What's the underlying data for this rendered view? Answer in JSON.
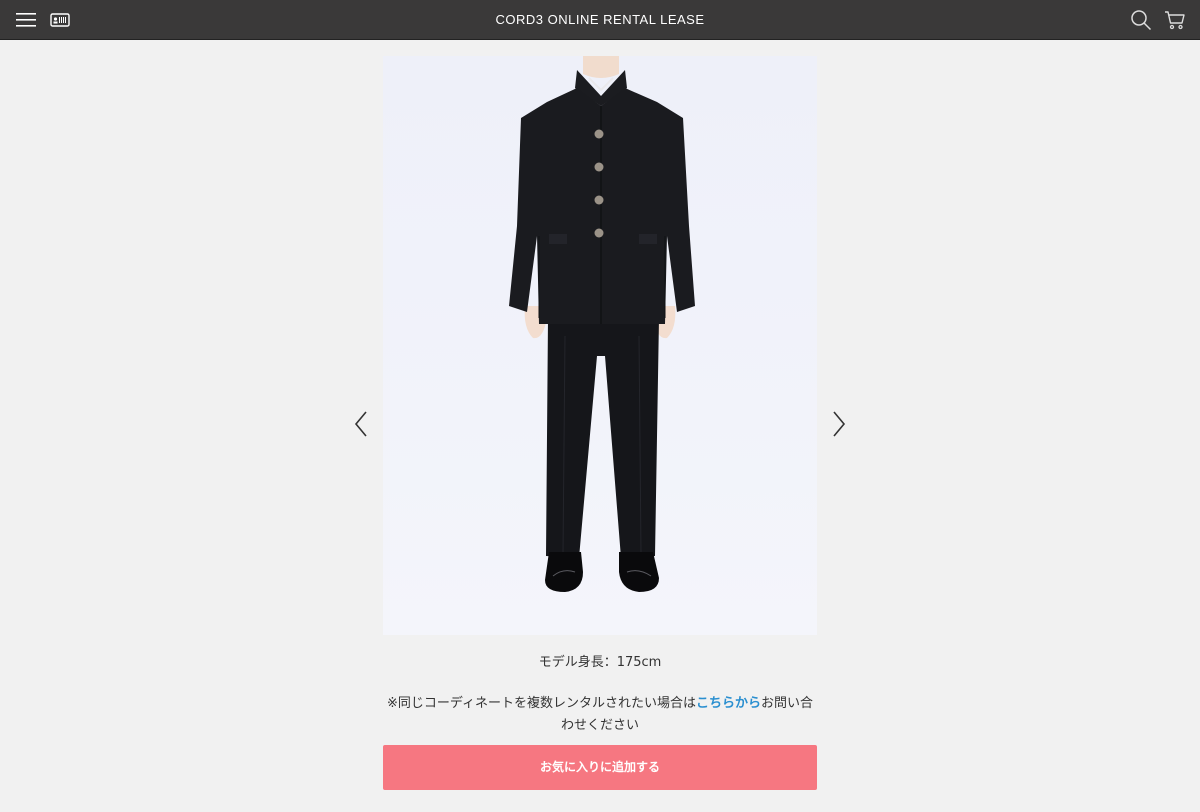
{
  "header": {
    "title": "CORD3 ONLINE RENTAL LEASE",
    "icons": [
      "menu-icon",
      "member-card-icon",
      "search-icon",
      "cart-icon"
    ],
    "background": "#3a3939"
  },
  "product": {
    "image_alt": "Black gakuran school uniform worn by model",
    "model_height": "モデル身長：175cm",
    "notice_before": "※同じコーディネートを複数レンタルされたい場合は",
    "notice_link": "こちらから",
    "notice_after": "お問い合わせください",
    "favorite_button": "お気に入りに追加する"
  },
  "colors": {
    "accent": "#f67781",
    "link": "#2a8fd0",
    "background": "#f1f1f1"
  }
}
